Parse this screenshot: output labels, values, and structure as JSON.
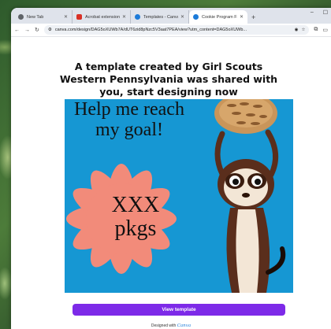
{
  "tabs": [
    {
      "title": "New Tab",
      "icon": "chrome-icon",
      "color": "#5f6368"
    },
    {
      "title": "Acrobat extension Upda",
      "icon": "acrobat-icon",
      "color": "#d93025"
    },
    {
      "title": "Templates - Canva",
      "icon": "canva-icon",
      "color": "#1c7bd9"
    },
    {
      "title": "Cookie Program Family",
      "icon": "canva-icon",
      "color": "#1c7bd9",
      "active": true
    }
  ],
  "browser": {
    "url": "canva.com/design/DAG5oXUWb7A/dUT6zid8pNzc5V3aat7PEA/view?utm_content=DAG5oXUWb...",
    "new_tab_glyph": "+",
    "minimize_glyph": "–",
    "maximize_glyph": "☐"
  },
  "page": {
    "headline": "A template created by Girl Scouts Western Pennsylvania was shared with you, start designing now",
    "view_button": "View template",
    "designed_with": "Designed with",
    "brand": "Canva"
  },
  "design": {
    "text_top": "Help me reach my goal!",
    "text_center": "XXX pkgs",
    "colors": {
      "background": "#1697d3",
      "flower": "#f28b7a",
      "cookie": "#c9955a",
      "ferret": "#5a2e1c"
    }
  },
  "colors": {
    "accent": "#7d2ae8",
    "brand_blue": "#1c7bd9"
  }
}
